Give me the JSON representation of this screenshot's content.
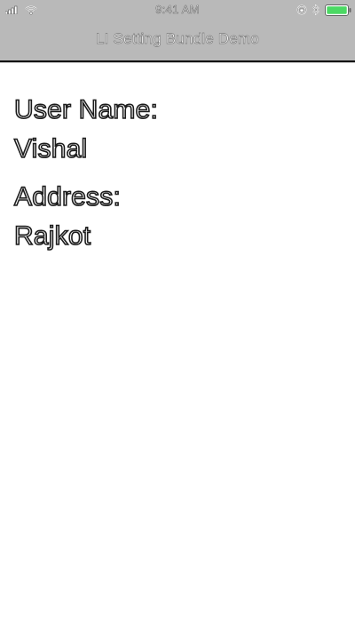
{
  "status_bar": {
    "time": "9:41 AM",
    "icons": [
      "signal-icon",
      "wifi-icon",
      "orientation-lock-icon",
      "bluetooth-icon",
      "battery-icon"
    ],
    "battery_color": "#4cd964"
  },
  "nav": {
    "title": "LI Setting Bundle Demo"
  },
  "content": {
    "user_name_label": "User Name:",
    "user_name_value": "Vishal",
    "address_label": "Address:",
    "address_value": "Rajkot"
  },
  "colors": {
    "bar_background": "#b9b9b9",
    "text_outline": "#1c1c1c"
  }
}
